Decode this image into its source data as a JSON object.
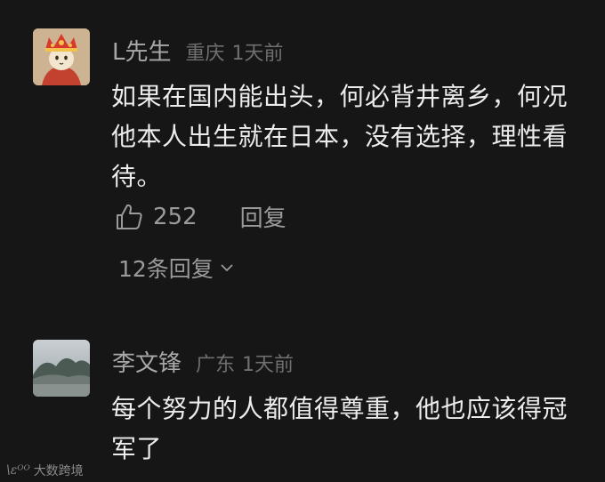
{
  "comments": [
    {
      "username": "L先生",
      "location": "重庆",
      "time": "1天前",
      "content": "如果在国内能出头，何必背井离乡，何况他本人出生就在日本，没有选择，理性看待。",
      "likes": "252",
      "reply_label": "回复",
      "replies_label": "12条回复"
    },
    {
      "username": "李文锋",
      "location": "广东",
      "time": "1天前",
      "content": "每个努力的人都值得尊重，他也应该得冠军了"
    }
  ],
  "watermark": {
    "logo": "\\ɛᴼᴼ",
    "text": "大数跨境"
  },
  "icons": {
    "like": "thumbs-up-icon",
    "chevron": "chevron-down-icon"
  },
  "colors": {
    "background": "#161616",
    "username": "#a8a8a8",
    "meta": "#6f6f6f",
    "content": "#ececec",
    "action": "#9a9a9a"
  }
}
